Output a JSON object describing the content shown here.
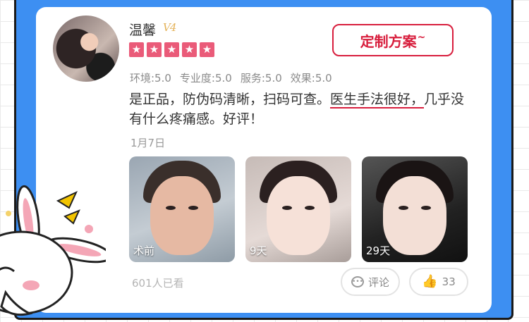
{
  "user": {
    "name": "温馨",
    "level": "V4"
  },
  "rating": {
    "stars": 5
  },
  "action": {
    "custom_plan_label": "定制方案",
    "custom_plan_mark": "~"
  },
  "scores": [
    {
      "label": "环境:5.0"
    },
    {
      "label": "专业度:5.0"
    },
    {
      "label": "服务:5.0"
    },
    {
      "label": "效果:5.0"
    }
  ],
  "review": {
    "text_before": "是正品，防伪码清晰，扫码可查。",
    "highlight": "医生手法很好，",
    "text_after": "几乎没有什么疼痛感。好评！"
  },
  "date": "1月7日",
  "photos": [
    {
      "caption": "术前"
    },
    {
      "caption": "9天"
    },
    {
      "caption": "29天"
    }
  ],
  "footer": {
    "views": "601人已看",
    "comment_label": "评论",
    "like_count": "33"
  },
  "colors": {
    "accent": "#d81e3d",
    "frame": "#3d8ff2",
    "star": "#ea5b79"
  }
}
